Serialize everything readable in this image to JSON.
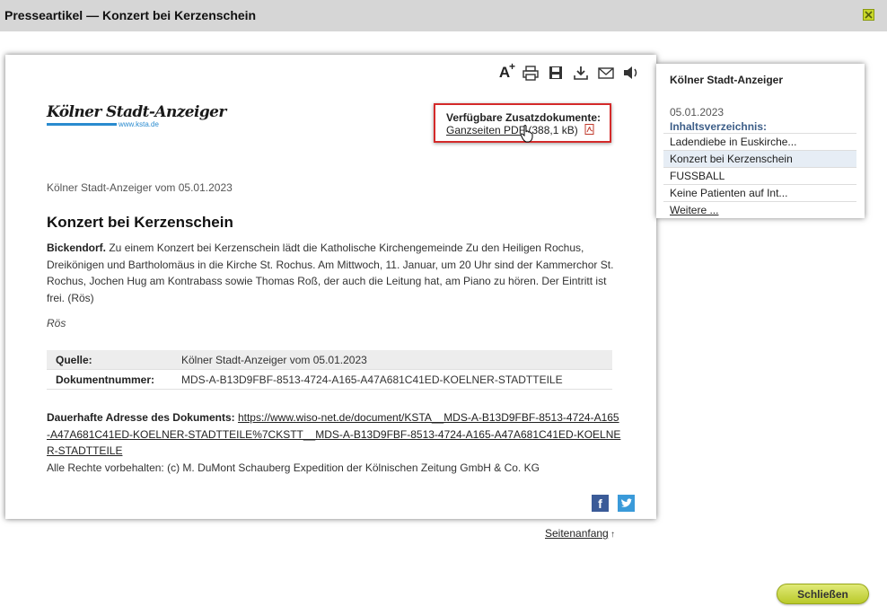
{
  "window": {
    "title": "Presseartikel — Konzert bei Kerzenschein"
  },
  "icons": {
    "close": "close-x-icon",
    "font": "font-size-icon",
    "print": "print-icon",
    "save": "save-icon",
    "download": "download-icon",
    "mail": "mail-icon",
    "audio": "speaker-icon",
    "pdf": "pdf-icon",
    "facebook": "facebook-icon",
    "twitter": "twitter-icon"
  },
  "colors": {
    "accent": "#c9d82a",
    "highlight_border": "#d42a2a",
    "toc_heading": "#3d5e88",
    "brand_blue": "#2a8bcf"
  },
  "logo": {
    "name": "Kölner Stadt-Anzeiger",
    "url": "www.ksta.de"
  },
  "docs": {
    "label": "Verfügbare Zusatzdokumente:",
    "link_text": "Ganzseiten PDF",
    "size": "(388,1 kB)"
  },
  "article": {
    "source_line": "Kölner Stadt-Anzeiger vom 05.01.2023",
    "headline": "Konzert bei Kerzenschein",
    "dateline": "Bickendorf.",
    "body": " Zu einem Konzert bei Kerzenschein lädt die Katholische Kirchengemeinde Zu den Heiligen Rochus, Dreikönigen und Bartholomäus in die Kirche St. Rochus. Am Mittwoch, 11. Januar, um 20 Uhr sind der Kammerchor St. Rochus, Jochen Hug am Kontrabass sowie Thomas Roß, der auch die Leitung hat, am Piano zu hören. Der Eintritt ist frei. (Rös)",
    "author": "Rös"
  },
  "meta": {
    "source_label": "Quelle:",
    "source_value": "Kölner Stadt-Anzeiger vom 05.01.2023",
    "docnum_label": "Dokumentnummer:",
    "docnum_value": "MDS-A-B13D9FBF-8513-4724-A165-A47A681C41ED-KOELNER-STADTTEILE"
  },
  "permalink": {
    "label": "Dauerhafte Adresse des Dokuments:",
    "url": "https://www.wiso-net.de/document/KSTA__MDS-A-B13D9FBF-8513-4724-A165-A47A681C41ED-KOELNER-STADTTEILE%7CKSTT__MDS-A-B13D9FBF-8513-4724-A165-A47A681C41ED-KOELNER-STADTTEILE",
    "rights": "Alle Rechte vorbehalten: (c) M. DuMont Schauberg Expedition der Kölnischen Zeitung GmbH & Co. KG"
  },
  "toc": {
    "publication": "Kölner Stadt-Anzeiger",
    "date": "05.01.2023",
    "heading": "Inhaltsverzeichnis:",
    "items": [
      "Ladendiebe in Euskirche...",
      "Konzert bei Kerzenschein",
      "FUSSBALL",
      "Keine Patienten auf Int...",
      "Weitere ..."
    ]
  },
  "footer": {
    "back_to_top": "Seitenanfang",
    "close_label": "Schließen"
  }
}
